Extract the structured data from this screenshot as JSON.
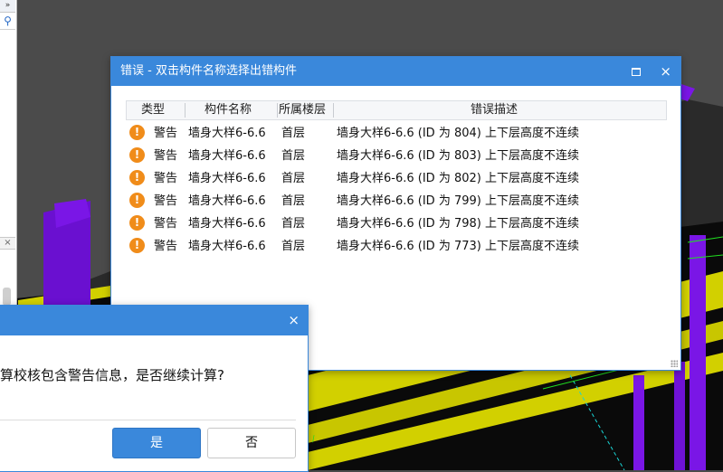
{
  "side_panel": {
    "collapse_label": "»",
    "close_label": "×"
  },
  "error_dialog": {
    "title": "错误 - 双击构件名称选择出错构件",
    "close_label": "×",
    "columns": [
      "类型",
      "构件名称",
      "所属楼层",
      "错误描述"
    ],
    "rows": [
      {
        "type": "警告",
        "name": "墙身大样6-6.6",
        "floor": "首层",
        "desc": "墙身大样6-6.6 (ID 为 804) 上下层高度不连续"
      },
      {
        "type": "警告",
        "name": "墙身大样6-6.6",
        "floor": "首层",
        "desc": "墙身大样6-6.6 (ID 为 803) 上下层高度不连续"
      },
      {
        "type": "警告",
        "name": "墙身大样6-6.6",
        "floor": "首层",
        "desc": "墙身大样6-6.6 (ID 为 802) 上下层高度不连续"
      },
      {
        "type": "警告",
        "name": "墙身大样6-6.6",
        "floor": "首层",
        "desc": "墙身大样6-6.6 (ID 为 799) 上下层高度不连续"
      },
      {
        "type": "警告",
        "name": "墙身大样6-6.6",
        "floor": "首层",
        "desc": "墙身大样6-6.6 (ID 为 798) 上下层高度不连续"
      },
      {
        "type": "警告",
        "name": "墙身大样6-6.6",
        "floor": "首层",
        "desc": "墙身大样6-6.6 (ID 为 773) 上下层高度不连续"
      }
    ],
    "warn_icon": "exclamation-circle",
    "warn_color": "#f08c1a"
  },
  "confirm_dialog": {
    "close_label": "×",
    "message": "算校核包含警告信息，是否继续计算?",
    "yes_label": "是",
    "no_label": "否"
  },
  "colors": {
    "title_bar": "#3a88db",
    "beam": "#d4d300",
    "column": "#7a16e6",
    "viewport": "#4a4a4a"
  }
}
